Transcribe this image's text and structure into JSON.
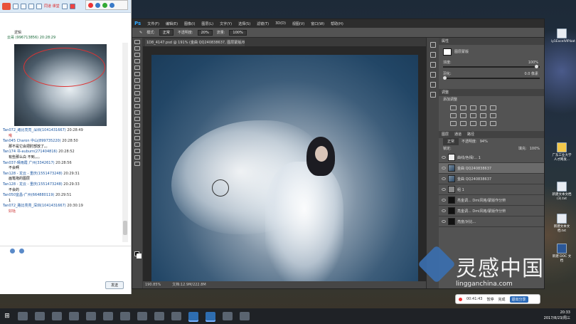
{
  "chat": {
    "title": "同道 课堂",
    "top_line": "逻辑",
    "top_name": "云哥 (996713856) 20:28:29",
    "messages": [
      {
        "name": "Tan072_路比亮亮_深圳",
        "id": "(1041431667)",
        "time": "20:28:49",
        "body": "哦",
        "red": true
      },
      {
        "name": "Tan045 Charon 中山",
        "id": "(899735220)",
        "time": "20:28:50",
        "body": "那不是它会把肘部放了。。",
        "red": false
      },
      {
        "name": "Tan174 书-auburn",
        "id": "(271404816)",
        "time": "20:28:52",
        "body": "有些那么白 不到。。。",
        "red": false
      },
      {
        "name": "Tan037-晴雨霞 广州",
        "id": "(3342617)",
        "time": "20:28:56",
        "body": "不会啊",
        "red": false
      },
      {
        "name": "Tan128 - 龙云 - 重庆",
        "id": "(1551473248)",
        "time": "20:29:31",
        "body": " 画笔拖的图层",
        "red": false
      },
      {
        "name": "Tan128 - 龙云 - 重庆",
        "id": "(1551473248)",
        "time": "20:29:33",
        "body": "不会的",
        "red": false
      },
      {
        "name": "Tan050宜昌-广州",
        "id": "(664880119)",
        "time": "20:29:51",
        "body": "1",
        "red": false
      },
      {
        "name": "Tan072_路比亮亮_深圳",
        "id": "(1041431667)",
        "time": "20:30:19",
        "body": "好哒",
        "red": true
      }
    ],
    "send_label": "发送"
  },
  "ps": {
    "logo": "Ps",
    "menu": [
      "文件(F)",
      "编辑(E)",
      "图像(I)",
      "图层(L)",
      "文字(Y)",
      "选择(S)",
      "滤镜(T)",
      "3D(D)",
      "视图(V)",
      "窗口(W)",
      "帮助(H)"
    ],
    "options": {
      "mode_label": "模式:",
      "mode_value": "正常",
      "opacity_label": "不透明度:",
      "opacity_value": "20%",
      "flow_label": "流量:",
      "flow_value": "100%"
    },
    "doc_tab": "1D8_4147.psd @ 191% (金曲 QQ240838637, 图层蒙版/8) *",
    "status_zoom": "190.85%",
    "status_doc": "文档:12.9M/222.8M",
    "panels": {
      "properties": "属性",
      "mask_label": "图层蒙版",
      "density_label": "浓度:",
      "density_value": "100%",
      "feather_label": "羽化:",
      "feather_value": "0.0 像素",
      "adjust_title": "调整",
      "add_adjust": "添加调整",
      "layers_tabs": [
        "图层",
        "通道",
        "路径"
      ],
      "blend_mode": "正常",
      "opacity_label": "不透明度:",
      "opacity_value": "94%",
      "fill_label": "填充:",
      "fill_value": "100%",
      "lock_label": "锁定:",
      "layers": [
        {
          "name": "曲线/色相/... 1",
          "sel": false
        },
        {
          "name": "金曲 QQ240838637",
          "sel": true
        },
        {
          "name": "金曲 QQ240838637",
          "sel": false
        },
        {
          "name": "组 1",
          "sel": false
        },
        {
          "name": "亮金调... Dmi风格/蒙版作分辨",
          "sel": false
        },
        {
          "name": "亮金调... Dmi风格/蒙版作分辨",
          "sel": false
        },
        {
          "name": "亮度/对比...",
          "sel": false
        }
      ]
    }
  },
  "recording": {
    "time": "00:41:43",
    "btn1": "暂停",
    "btn2": "完成",
    "btn3": "退出分享"
  },
  "watermark": {
    "title": "灵感中国",
    "url": "lingganchina.com"
  },
  "desktop_icons": [
    {
      "label": "iy1ExcelVIP.bat",
      "kind": "file"
    },
    {
      "label": "广东工业大学 人才网发...",
      "kind": "file"
    },
    {
      "label": "新建文本文档 (3).txt",
      "kind": "file"
    },
    {
      "label": "新建文本文档.txt",
      "kind": "file"
    },
    {
      "label": "新建 DOC 文档",
      "kind": "word"
    }
  ],
  "clock": {
    "time": "20:33",
    "date": "2017/8/23/周三"
  }
}
